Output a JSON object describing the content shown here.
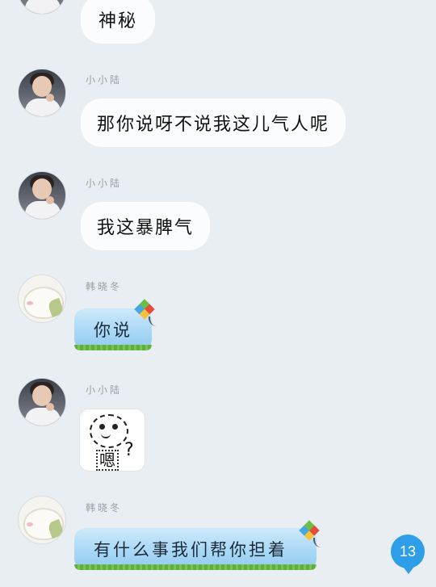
{
  "messages": [
    {
      "sender": "",
      "text": "神秘"
    },
    {
      "sender": "小小陆",
      "text": "那你说呀不说我这儿气人呢"
    },
    {
      "sender": "小小陆",
      "text": "我这暴脾气"
    },
    {
      "sender": "韩晓冬",
      "text": "你说"
    },
    {
      "sender": "小小陆",
      "sticker_text": "嗯",
      "sticker_mark": "?"
    },
    {
      "sender": "韩晓冬",
      "text": "有什么事我们帮你担着"
    }
  ],
  "unread_badge": "13",
  "colors": {
    "background": "#e9eef2",
    "bubble_white": "#fbfcfd",
    "bubble_blue": "#a9d8f6",
    "badge": "#2f9ee8"
  },
  "icons": [
    "avatar",
    "kite-icon",
    "sticker"
  ]
}
